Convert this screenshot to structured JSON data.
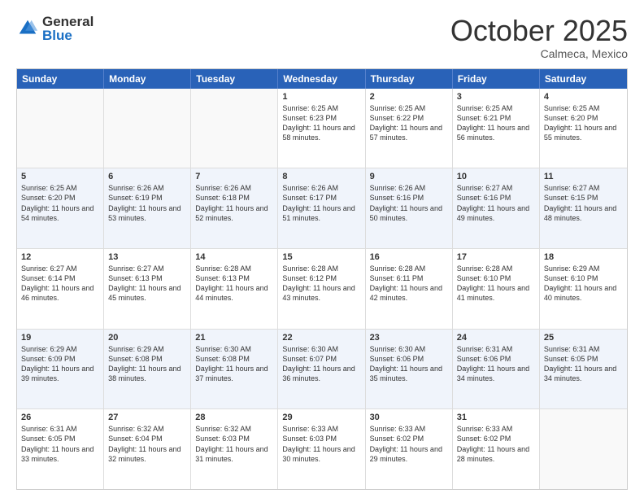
{
  "logo": {
    "general": "General",
    "blue": "Blue"
  },
  "title": "October 2025",
  "location": "Calmeca, Mexico",
  "days_header": [
    "Sunday",
    "Monday",
    "Tuesday",
    "Wednesday",
    "Thursday",
    "Friday",
    "Saturday"
  ],
  "weeks": [
    [
      {
        "day": "",
        "info": ""
      },
      {
        "day": "",
        "info": ""
      },
      {
        "day": "",
        "info": ""
      },
      {
        "day": "1",
        "info": "Sunrise: 6:25 AM\nSunset: 6:23 PM\nDaylight: 11 hours and 58 minutes."
      },
      {
        "day": "2",
        "info": "Sunrise: 6:25 AM\nSunset: 6:22 PM\nDaylight: 11 hours and 57 minutes."
      },
      {
        "day": "3",
        "info": "Sunrise: 6:25 AM\nSunset: 6:21 PM\nDaylight: 11 hours and 56 minutes."
      },
      {
        "day": "4",
        "info": "Sunrise: 6:25 AM\nSunset: 6:20 PM\nDaylight: 11 hours and 55 minutes."
      }
    ],
    [
      {
        "day": "5",
        "info": "Sunrise: 6:25 AM\nSunset: 6:20 PM\nDaylight: 11 hours and 54 minutes."
      },
      {
        "day": "6",
        "info": "Sunrise: 6:26 AM\nSunset: 6:19 PM\nDaylight: 11 hours and 53 minutes."
      },
      {
        "day": "7",
        "info": "Sunrise: 6:26 AM\nSunset: 6:18 PM\nDaylight: 11 hours and 52 minutes."
      },
      {
        "day": "8",
        "info": "Sunrise: 6:26 AM\nSunset: 6:17 PM\nDaylight: 11 hours and 51 minutes."
      },
      {
        "day": "9",
        "info": "Sunrise: 6:26 AM\nSunset: 6:16 PM\nDaylight: 11 hours and 50 minutes."
      },
      {
        "day": "10",
        "info": "Sunrise: 6:27 AM\nSunset: 6:16 PM\nDaylight: 11 hours and 49 minutes."
      },
      {
        "day": "11",
        "info": "Sunrise: 6:27 AM\nSunset: 6:15 PM\nDaylight: 11 hours and 48 minutes."
      }
    ],
    [
      {
        "day": "12",
        "info": "Sunrise: 6:27 AM\nSunset: 6:14 PM\nDaylight: 11 hours and 46 minutes."
      },
      {
        "day": "13",
        "info": "Sunrise: 6:27 AM\nSunset: 6:13 PM\nDaylight: 11 hours and 45 minutes."
      },
      {
        "day": "14",
        "info": "Sunrise: 6:28 AM\nSunset: 6:13 PM\nDaylight: 11 hours and 44 minutes."
      },
      {
        "day": "15",
        "info": "Sunrise: 6:28 AM\nSunset: 6:12 PM\nDaylight: 11 hours and 43 minutes."
      },
      {
        "day": "16",
        "info": "Sunrise: 6:28 AM\nSunset: 6:11 PM\nDaylight: 11 hours and 42 minutes."
      },
      {
        "day": "17",
        "info": "Sunrise: 6:28 AM\nSunset: 6:10 PM\nDaylight: 11 hours and 41 minutes."
      },
      {
        "day": "18",
        "info": "Sunrise: 6:29 AM\nSunset: 6:10 PM\nDaylight: 11 hours and 40 minutes."
      }
    ],
    [
      {
        "day": "19",
        "info": "Sunrise: 6:29 AM\nSunset: 6:09 PM\nDaylight: 11 hours and 39 minutes."
      },
      {
        "day": "20",
        "info": "Sunrise: 6:29 AM\nSunset: 6:08 PM\nDaylight: 11 hours and 38 minutes."
      },
      {
        "day": "21",
        "info": "Sunrise: 6:30 AM\nSunset: 6:08 PM\nDaylight: 11 hours and 37 minutes."
      },
      {
        "day": "22",
        "info": "Sunrise: 6:30 AM\nSunset: 6:07 PM\nDaylight: 11 hours and 36 minutes."
      },
      {
        "day": "23",
        "info": "Sunrise: 6:30 AM\nSunset: 6:06 PM\nDaylight: 11 hours and 35 minutes."
      },
      {
        "day": "24",
        "info": "Sunrise: 6:31 AM\nSunset: 6:06 PM\nDaylight: 11 hours and 34 minutes."
      },
      {
        "day": "25",
        "info": "Sunrise: 6:31 AM\nSunset: 6:05 PM\nDaylight: 11 hours and 34 minutes."
      }
    ],
    [
      {
        "day": "26",
        "info": "Sunrise: 6:31 AM\nSunset: 6:05 PM\nDaylight: 11 hours and 33 minutes."
      },
      {
        "day": "27",
        "info": "Sunrise: 6:32 AM\nSunset: 6:04 PM\nDaylight: 11 hours and 32 minutes."
      },
      {
        "day": "28",
        "info": "Sunrise: 6:32 AM\nSunset: 6:03 PM\nDaylight: 11 hours and 31 minutes."
      },
      {
        "day": "29",
        "info": "Sunrise: 6:33 AM\nSunset: 6:03 PM\nDaylight: 11 hours and 30 minutes."
      },
      {
        "day": "30",
        "info": "Sunrise: 6:33 AM\nSunset: 6:02 PM\nDaylight: 11 hours and 29 minutes."
      },
      {
        "day": "31",
        "info": "Sunrise: 6:33 AM\nSunset: 6:02 PM\nDaylight: 11 hours and 28 minutes."
      },
      {
        "day": "",
        "info": ""
      }
    ]
  ]
}
